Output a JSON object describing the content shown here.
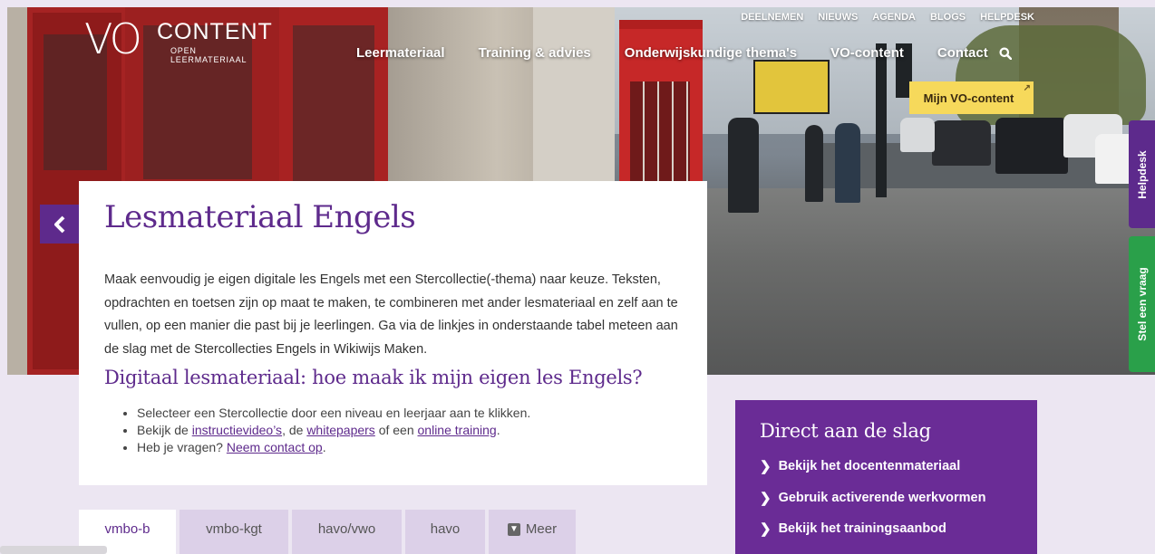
{
  "logo": {
    "vo": "VO",
    "content": "CONTENT",
    "subtitle": "OPEN LEERMATERIAAL"
  },
  "topnav": [
    "DEELNEMEN",
    "NIEUWS",
    "AGENDA",
    "BLOGS",
    "HELPDESK"
  ],
  "mainnav": [
    "Leermateriaal",
    "Training & advies",
    "Onderwijskundige thema's",
    "VO-content",
    "Contact"
  ],
  "mijn_button": "Mijn VO-content",
  "side_tabs": {
    "helpdesk": "Helpdesk",
    "vraag": "Stel een vraag"
  },
  "page": {
    "title": "Lesmateriaal Engels",
    "intro": "Maak eenvoudig je eigen digitale les Engels met een Stercollectie(-thema) naar keuze. Teksten, opdrachten en toetsen zijn op maat te maken, te combineren met ander lesmateriaal en zelf aan te vullen, op een manier die past bij je leerlingen. Ga via de linkjes in onderstaande tabel meteen aan de slag met de Stercollecties Engels in Wikiwijs Maken.",
    "subheading": "Digitaal lesmateriaal: hoe maak ik mijn eigen les Engels?",
    "bullet1": "Selecteer een Stercollectie door een niveau en leerjaar aan te klikken.",
    "bullet2_pre": "Bekijk de ",
    "bullet2_link1": "instructievideo’s",
    "bullet2_mid1": ", de ",
    "bullet2_link2": "whitepapers",
    "bullet2_mid2": " of een ",
    "bullet2_link3": "online training",
    "bullet2_post": ".",
    "bullet3_pre": "Heb je vragen? ",
    "bullet3_link": "Neem contact op",
    "bullet3_post": "."
  },
  "direct": {
    "title": "Direct aan de slag",
    "items": [
      "Bekijk het docentenmateriaal",
      "Gebruik activerende werkvormen",
      "Bekijk het trainingsaanbod"
    ]
  },
  "level_tabs": [
    "vmbo-b",
    "vmbo-kgt",
    "havo/vwo",
    "havo",
    "Meer"
  ],
  "colors": {
    "purple": "#5e2a8c",
    "yellow": "#f6d95b",
    "green": "#2aa04a"
  }
}
